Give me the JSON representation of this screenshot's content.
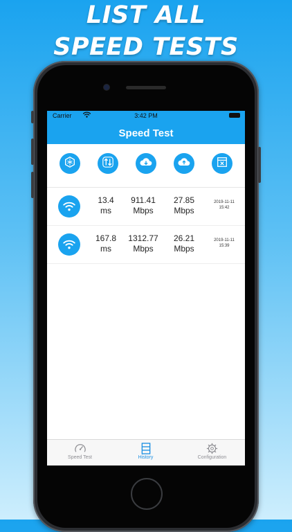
{
  "promo": {
    "line1": "LIST ALL",
    "line2": "SPEED TESTS"
  },
  "status_bar": {
    "carrier": "Carrier",
    "time": "3:42 PM"
  },
  "app": {
    "title": "Speed Test",
    "accent": "#1aa3ef"
  },
  "toolbar": {
    "buttons": [
      {
        "icon": "ping-icon",
        "label": ""
      },
      {
        "icon": "up-down-arrows-icon",
        "label": ""
      },
      {
        "icon": "cloud-download-icon",
        "label": ""
      },
      {
        "icon": "cloud-upload-icon",
        "label": ""
      },
      {
        "icon": "delete-box-icon",
        "label": ""
      }
    ]
  },
  "results": [
    {
      "ping": "13.4",
      "ping_unit": "ms",
      "download": "911.41",
      "download_unit": "Mbps",
      "upload": "27.85",
      "upload_unit": "Mbps",
      "date": "2019-11-11",
      "time": "15:42"
    },
    {
      "ping": "167.8",
      "ping_unit": "ms",
      "download": "1312.77",
      "download_unit": "Mbps",
      "upload": "26.21",
      "upload_unit": "Mbps",
      "date": "2019-11-11",
      "time": "15:39"
    }
  ],
  "tabbar": {
    "tabs": [
      {
        "label": "Speed Test",
        "icon": "speedometer-icon",
        "active": false
      },
      {
        "label": "History",
        "icon": "history-list-icon",
        "active": true
      },
      {
        "label": "Configuration",
        "icon": "gear-icon",
        "active": false
      }
    ]
  }
}
